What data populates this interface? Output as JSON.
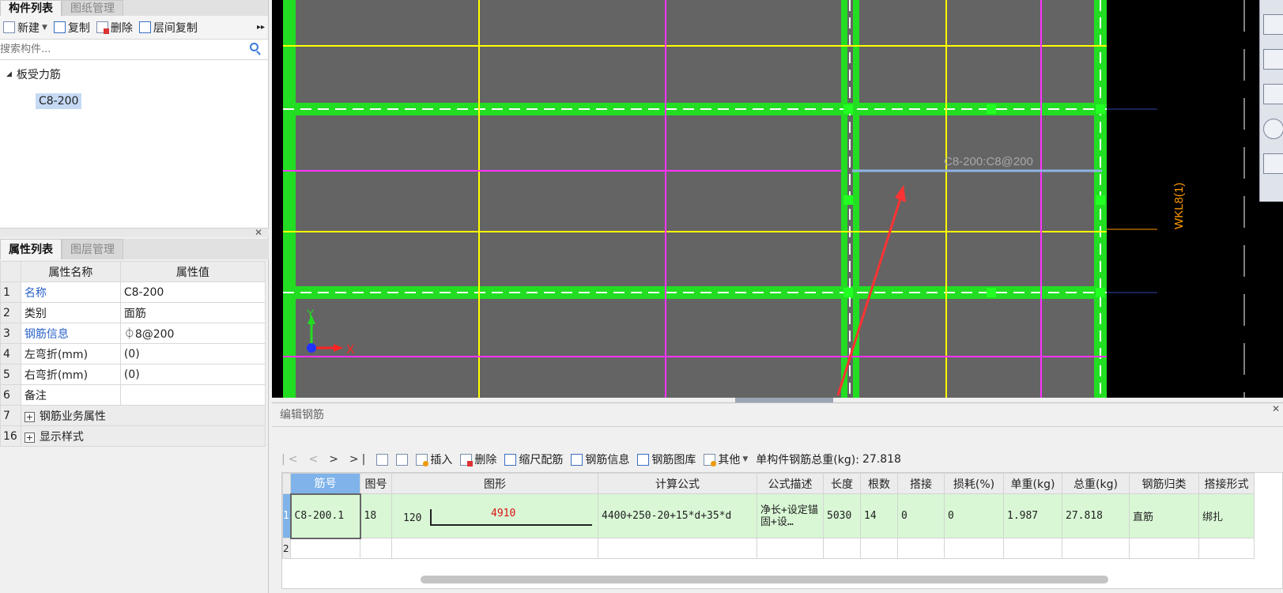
{
  "left_panel": {
    "tabs": [
      "构件列表",
      "图纸管理"
    ],
    "toolbar": {
      "new": "新建",
      "copy": "复制",
      "delete": "删除",
      "floor_copy": "层间复制",
      "more": "▸▸"
    },
    "search": {
      "placeholder": "搜索构件..."
    },
    "tree": {
      "group": "板受力筋",
      "items": [
        "C8-200"
      ]
    }
  },
  "property_panel": {
    "tabs": [
      "属性列表",
      "图层管理"
    ],
    "headers": [
      "属性名称",
      "属性值"
    ],
    "rows": [
      {
        "num": "1",
        "name": "名称",
        "value": "C8-200"
      },
      {
        "num": "2",
        "name": "类别",
        "value": "面筋"
      },
      {
        "num": "3",
        "name": "钢筋信息",
        "value": "⏀8@200"
      },
      {
        "num": "4",
        "name": "左弯折(mm)",
        "value": "(0)"
      },
      {
        "num": "5",
        "name": "右弯折(mm)",
        "value": "(0)"
      },
      {
        "num": "6",
        "name": "备注",
        "value": ""
      },
      {
        "num": "7",
        "name": "钢筋业务属性",
        "value": ""
      },
      {
        "num": "16",
        "name": "显示样式",
        "value": ""
      }
    ]
  },
  "canvas": {
    "rebar_label": "C8-200:C8@200",
    "beam_label": "WKL8(1)",
    "axis_x": "X",
    "axis_y": "Y",
    "colors": {
      "background": "#000000",
      "slab": "#646464",
      "beam": "#22dd22",
      "yellow_line": "#ffff00",
      "magenta_line": "#ff33ff",
      "selected_rebar": "#8fb3e6",
      "arrow": "#ff3333",
      "beam_label": "#ff9900"
    }
  },
  "editor": {
    "title": "编辑钢筋",
    "toolbar": {
      "nav": [
        "|<",
        "<",
        ">",
        ">|"
      ],
      "insert": "插入",
      "delete": "删除",
      "scale_rebar": "缩尺配筋",
      "rebar_info": "钢筋信息",
      "rebar_library": "钢筋图库",
      "other": "其他",
      "total_weight_label": "单构件钢筋总重(kg):",
      "total_weight_value": "27.818"
    },
    "table": {
      "headers": [
        "筋号",
        "图号",
        "图形",
        "计算公式",
        "公式描述",
        "长度",
        "根数",
        "搭接",
        "损耗(%)",
        "单重(kg)",
        "总重(kg)",
        "钢筋归类",
        "搭接形式"
      ],
      "rows": [
        {
          "idx": "1",
          "bar_no": "C8-200.1",
          "fig_no": "18",
          "shape_left": "120",
          "shape_main": "4910",
          "formula": "4400+250-20+15*d+35*d",
          "desc": "净长+设定锚固+设…",
          "length": "5030",
          "count": "14",
          "lap": "0",
          "loss": "0",
          "unit_weight": "1.987",
          "total_weight": "27.818",
          "category": "直筋",
          "lap_type": "绑扎"
        },
        {
          "idx": "2"
        }
      ]
    }
  }
}
